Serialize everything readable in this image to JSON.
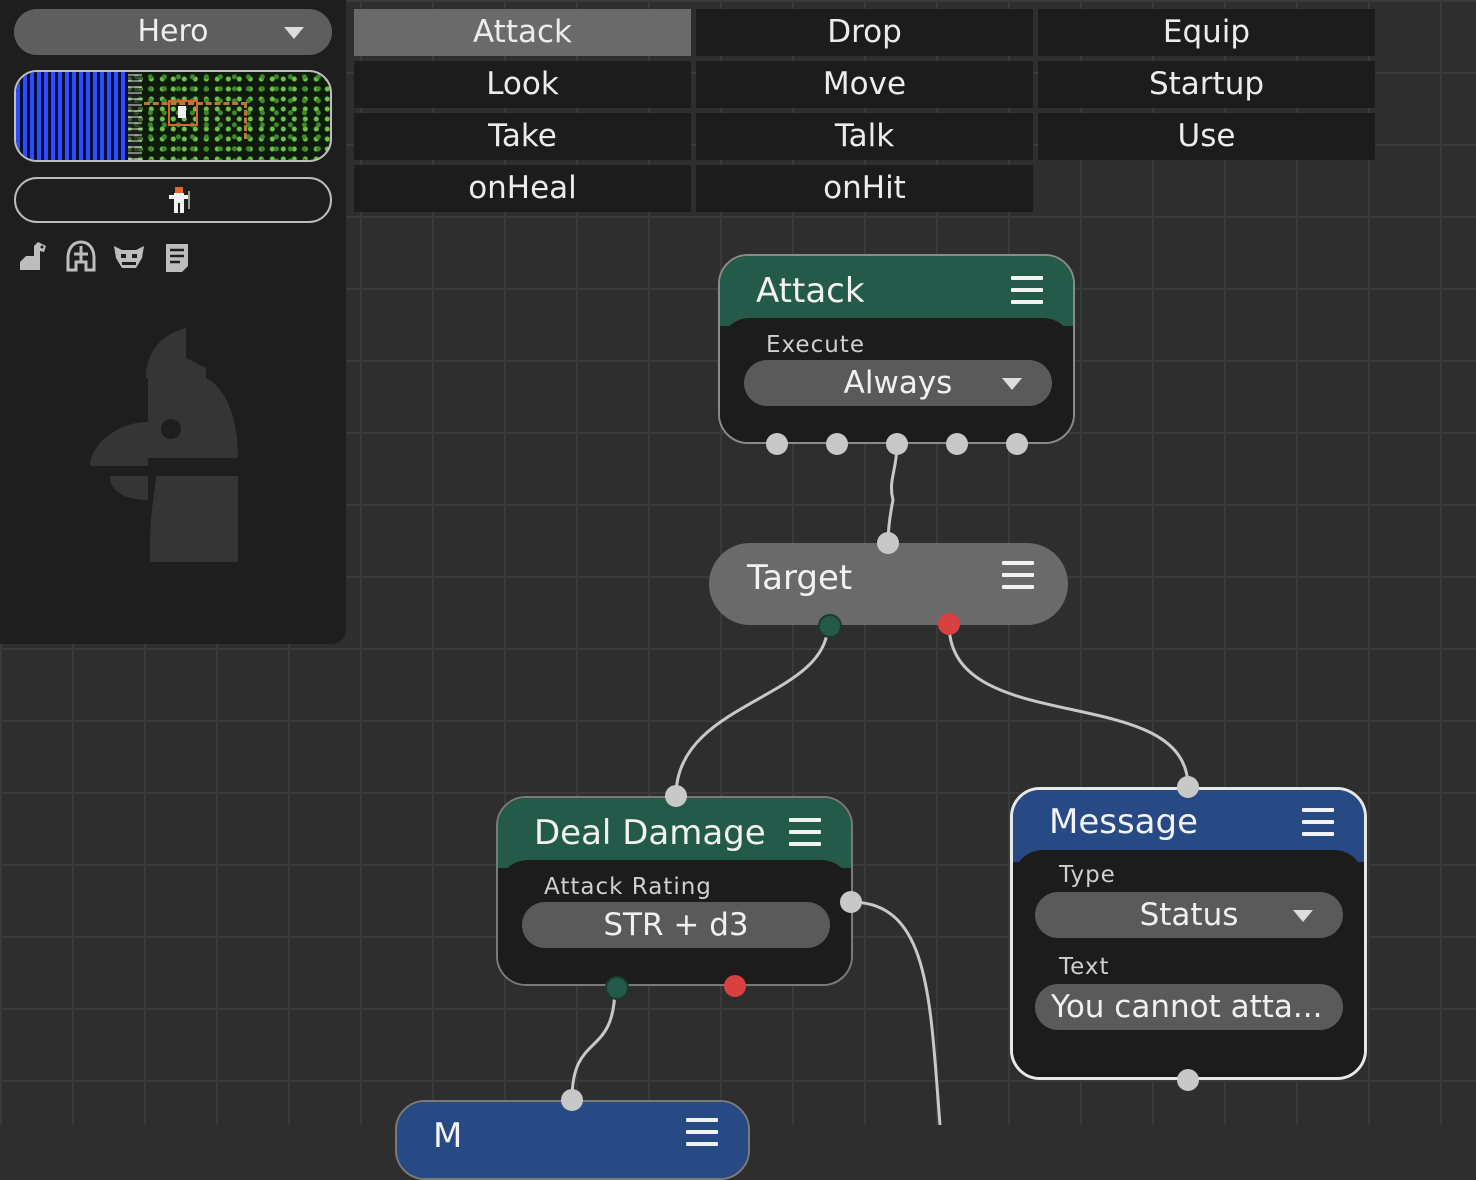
{
  "left_panel": {
    "actor_select": {
      "value": "Hero"
    }
  },
  "events": [
    {
      "label": "Attack",
      "active": true
    },
    {
      "label": "Drop",
      "active": false
    },
    {
      "label": "Equip",
      "active": false
    },
    {
      "label": "Look",
      "active": false
    },
    {
      "label": "Move",
      "active": false
    },
    {
      "label": "Startup",
      "active": false
    },
    {
      "label": "Take",
      "active": false
    },
    {
      "label": "Talk",
      "active": false
    },
    {
      "label": "Use",
      "active": false
    },
    {
      "label": "onHeal",
      "active": false
    },
    {
      "label": "onHit",
      "active": false
    }
  ],
  "nodes": {
    "attack": {
      "title": "Attack",
      "execute_label": "Execute",
      "execute_value": "Always"
    },
    "target": {
      "title": "Target"
    },
    "deal_damage": {
      "title": "Deal Damage",
      "rating_label": "Attack Rating",
      "rating_value": "STR + d3"
    },
    "message": {
      "title": "Message",
      "type_label": "Type",
      "type_value": "Status",
      "text_label": "Text",
      "text_value": "You cannot atta..."
    },
    "partial_bottom": {
      "title": "M"
    }
  },
  "colors": {
    "green_header": "#245a4a",
    "blue_header": "#284a84",
    "grey_node": "#6a6a6a",
    "port_red": "#d94040"
  }
}
